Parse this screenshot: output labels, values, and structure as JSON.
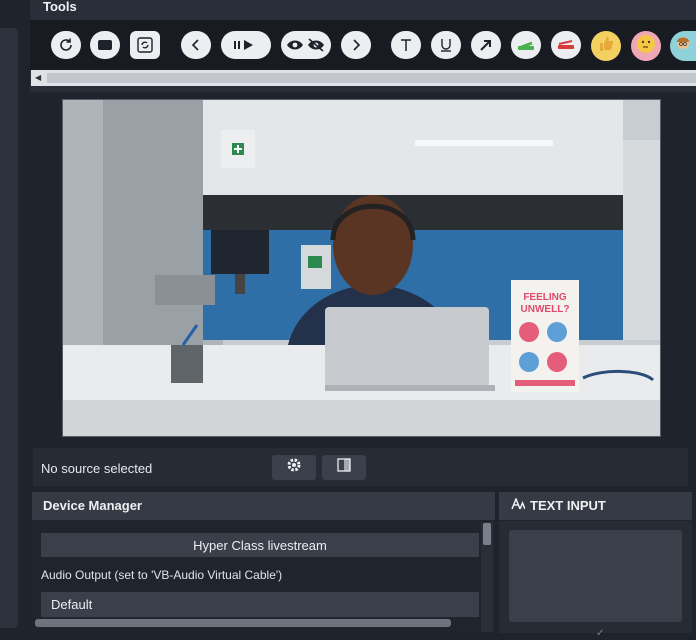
{
  "tools_panel": {
    "title": "Tools",
    "buttons": [
      {
        "name": "refresh-icon"
      },
      {
        "name": "layout-icon"
      },
      {
        "name": "sync-icon"
      },
      {
        "name": "previous-icon"
      },
      {
        "name": "pause-play-icon"
      },
      {
        "name": "show-hide-icon"
      },
      {
        "name": "next-icon"
      },
      {
        "name": "text-tool-icon"
      },
      {
        "name": "underline-tool-icon"
      },
      {
        "name": "arrow-tool-icon"
      },
      {
        "name": "battery-green-icon"
      },
      {
        "name": "battery-red-icon"
      },
      {
        "name": "thumbs-up-emoji"
      },
      {
        "name": "thinking-face-emoji"
      },
      {
        "name": "teacher-emoji"
      }
    ]
  },
  "preview": {
    "description_text": "",
    "poster_line1": "FEELING",
    "poster_line2": "UNWELL?"
  },
  "status_bar": {
    "source_text": "No source selected"
  },
  "device_manager": {
    "title": "Device Manager",
    "stream_button": "Hyper Class livestream",
    "audio_label": "Audio Output (set to 'VB-Audio Virtual Cable')",
    "audio_value": "Default"
  },
  "text_input": {
    "title": "TEXT INPUT"
  },
  "colors": {
    "panel_bg": "#292e39",
    "toolbar_bg": "#181b22",
    "button_bg": "#eceef1",
    "accent_green": "#4caf50",
    "accent_red": "#d93a3a"
  }
}
